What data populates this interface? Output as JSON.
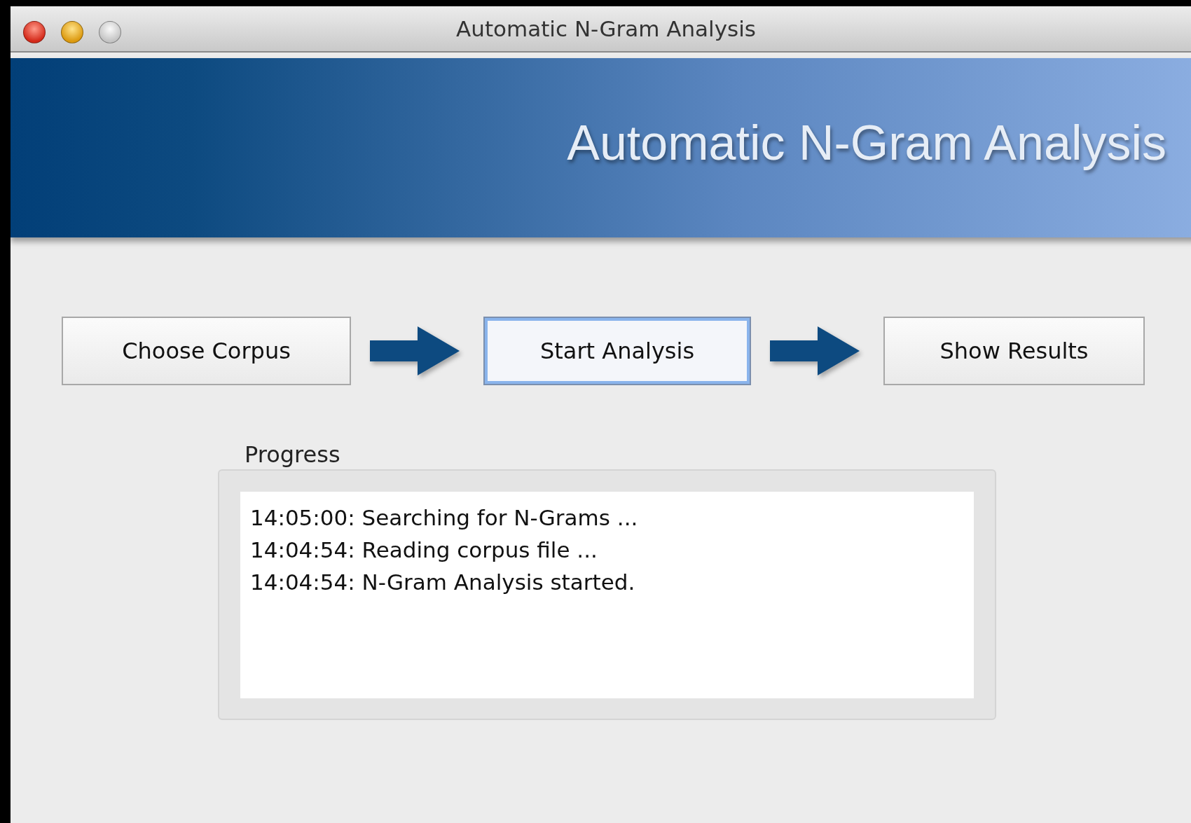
{
  "window": {
    "title": "Automatic N-Gram Analysis",
    "controls": [
      {
        "kind": "close"
      },
      {
        "kind": "minimize"
      },
      {
        "kind": "inactive"
      }
    ]
  },
  "banner": {
    "title": "Automatic N-Gram Analysis"
  },
  "steps": [
    {
      "label": "Choose Corpus",
      "focused": false
    },
    {
      "label": "Start Analysis",
      "focused": true
    },
    {
      "label": "Show Results",
      "focused": false
    }
  ],
  "progress": {
    "label": "Progress",
    "lines": [
      "14:05:00: Searching for N-Grams ...",
      "14:04:54: Reading corpus file ...",
      "14:04:54: N-Gram Analysis started."
    ]
  }
}
